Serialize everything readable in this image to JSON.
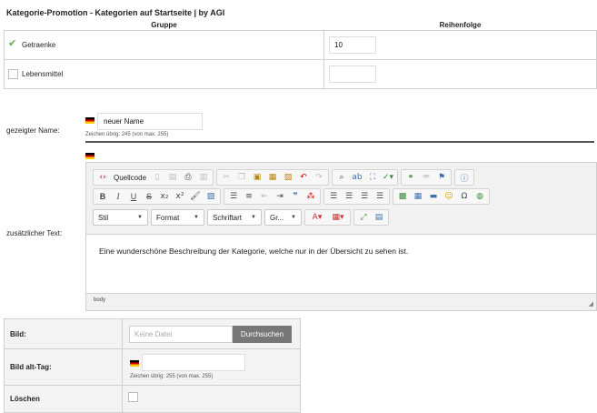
{
  "page_title": "Kategorie-Promotion - Kategorien auf Startseite | by AGI",
  "group_table": {
    "col_group": "Gruppe",
    "col_order": "Reihenfolge",
    "rows": [
      {
        "label": "Getraenke",
        "checked": true,
        "order": "10"
      },
      {
        "label": "Lebensmittel",
        "checked": false,
        "order": ""
      }
    ]
  },
  "name_field": {
    "label": "gezeigter Name:",
    "value": "neuer Name",
    "chars_left": "Zeichen übrig: 245 (von max. 255)",
    "flag_icon": "german-flag-icon"
  },
  "text_field": {
    "label": "zusätzlicher Text:",
    "flag_icon": "german-flag-icon",
    "content": "Eine wunderschöne Beschreibung der Kategorie, welche nur in der Übersicht zu sehen ist.",
    "status_path": "body"
  },
  "editor_toolbar": {
    "source_label": "Quellcode",
    "style_combo": "Stil",
    "format_combo": "Format",
    "font_combo": "Schriftart",
    "size_combo": "Gr..."
  },
  "bottom_table": {
    "image_label": "Bild:",
    "file_placeholder": "Keine Datei",
    "browse_label": "Durchsuchen",
    "alt_label": "Bild alt-Tag:",
    "alt_chars_left": "Zeichen übrig: 255 (von max. 255)",
    "delete_label": "Löschen"
  },
  "colors": {
    "check_green": "#6aa84f",
    "button_gray": "#777777",
    "divider": "#555555"
  }
}
